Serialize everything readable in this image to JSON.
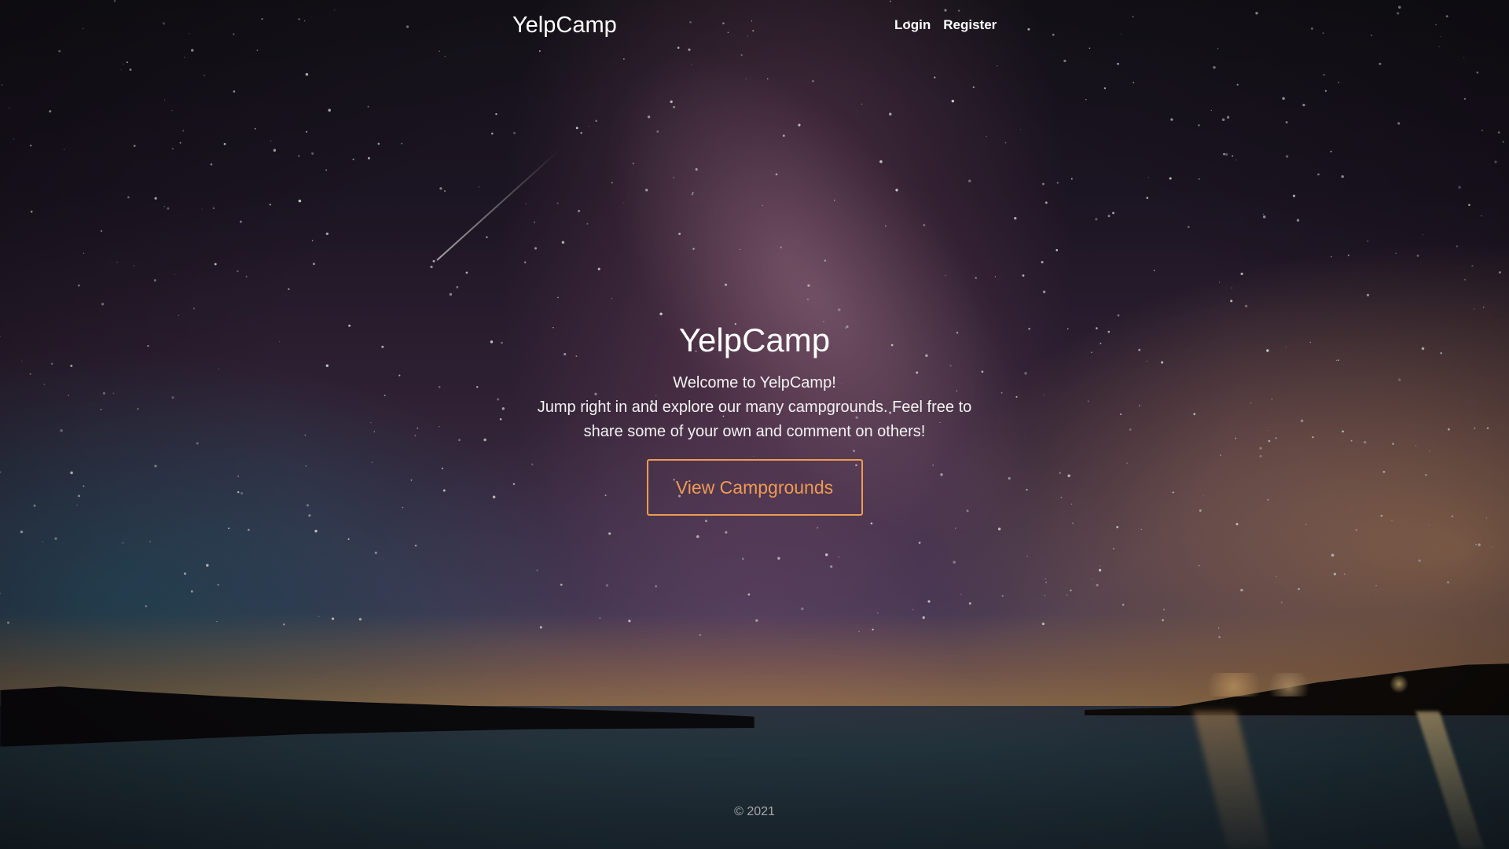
{
  "navbar": {
    "brand": "YelpCamp",
    "links": [
      {
        "label": "Login"
      },
      {
        "label": "Register"
      }
    ]
  },
  "hero": {
    "title": "YelpCamp",
    "welcome": "Welcome to YelpCamp!",
    "text": "Jump right in and explore our many campgrounds. Feel free to share some of your own and comment on others!",
    "button_label": "View Campgrounds"
  },
  "footer": {
    "copyright": "© 2021"
  },
  "colors": {
    "accent": "#ee9b52",
    "text": "#ffffff",
    "footer_text": "#a9a5ad"
  }
}
